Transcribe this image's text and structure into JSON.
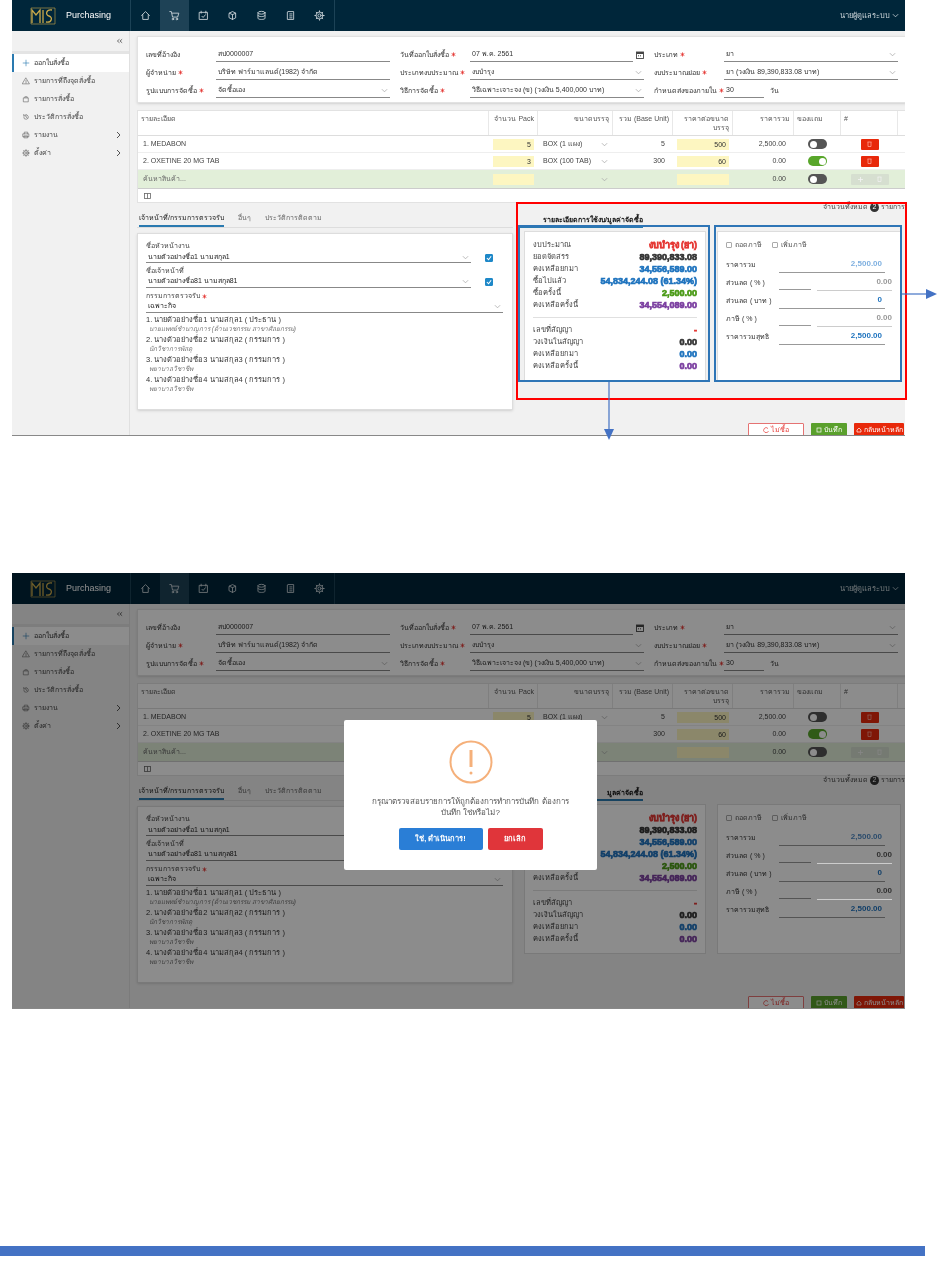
{
  "screens": [
    {
      "annotated": true,
      "app": {
        "title": "Purchasing",
        "user": "นายผู้ดูแลระบบ",
        "nav": [
          {
            "kind": "home",
            "selected": false
          },
          {
            "kind": "cart",
            "selected": true
          },
          {
            "kind": "calendar-check",
            "selected": false
          },
          {
            "kind": "package",
            "selected": false
          },
          {
            "kind": "database",
            "selected": false
          },
          {
            "kind": "document",
            "selected": false
          },
          {
            "kind": "gear",
            "selected": false
          }
        ]
      },
      "sidebar": {
        "items": [
          {
            "kind": "plus",
            "label": "ออกใบสั่งซื้อ",
            "selected": true,
            "expandable": false
          },
          {
            "kind": "warning",
            "label": "รายการที่ถึงจุดสั่งซื้อ",
            "selected": false,
            "expandable": false
          },
          {
            "kind": "bag",
            "label": "รายการสั่งซื้อ",
            "selected": false,
            "expandable": false
          },
          {
            "kind": "history",
            "label": "ประวัติการสั่งซื้อ",
            "selected": false,
            "expandable": false
          },
          {
            "kind": "printer",
            "label": "รายงาน",
            "selected": false,
            "expandable": true
          },
          {
            "kind": "gear",
            "label": "ตั้งค่า",
            "selected": false,
            "expandable": true
          }
        ]
      },
      "form": {
        "fields": [
          {
            "kind": "text",
            "label": "เลขที่อ้างอิง",
            "required": false,
            "value": "สป0000007"
          },
          {
            "kind": "date",
            "label": "วันที่ออกใบสั่งซื้อ",
            "required": true,
            "value": "07 พ.ค. 2561"
          },
          {
            "kind": "select",
            "label": "ประเภท",
            "required": true,
            "value": "ยา"
          },
          {
            "kind": "text",
            "label": "ผู้จำหน่าย",
            "required": true,
            "value": "บริษัท ฟาร์มาแลนด์(1982) จำกัด"
          },
          {
            "kind": "select",
            "label": "ประเภทงบประมาณ",
            "required": true,
            "value": "งบบำรุง"
          },
          {
            "kind": "select",
            "label": "งบประมาณย่อย",
            "required": true,
            "value": "ยา (วงเงิน 89,390,833.08 บาท)"
          },
          {
            "kind": "select",
            "label": "รูปแบบการจัดซื้อ",
            "required": true,
            "value": "จัดซื้อเอง"
          },
          {
            "kind": "select",
            "label": "วิธีการจัดซื้อ",
            "required": true,
            "value": "วิธีเฉพาะเจาะจง (ข) (วงเงิน 5,400,000 บาท)"
          },
          {
            "kind": "number",
            "label": "กำหนดส่งของภายใน",
            "required": true,
            "value": "30",
            "suffix": "วัน"
          }
        ]
      },
      "items_table": {
        "columns": [
          "รายละเอียด",
          "จำนวน Pack",
          "ขนาดบรรจุ",
          "รวม (Base Unit)",
          "ราคาต่อขนาดบรรจุ",
          "ราคารวม",
          "ของแถม",
          "#"
        ],
        "rows": [
          {
            "detail": "1. MEDABON",
            "pack": "5",
            "unit": "BOX (1 แผง)",
            "base": "5",
            "price": "500",
            "total": "2,500.00",
            "free": false
          },
          {
            "detail": "2. OXETINE 20 MG TAB",
            "pack": "3",
            "unit": "BOX (100 TAB)",
            "base": "300",
            "price": "60",
            "total": "0.00",
            "free": true
          }
        ],
        "search_row": {
          "placeholder": "ค้นหาสินค้า...",
          "total": "0.00",
          "free": false
        },
        "count": {
          "before": "จำนวนทั้งหมด",
          "value": "2",
          "after": "รายการ"
        }
      },
      "tabs": [
        {
          "label": "เจ้าหน้าที่/กรรมการตรวจรับ",
          "selected": true
        },
        {
          "label": "อื่นๆ",
          "selected": false
        },
        {
          "label": "ประวัติการติดตาม",
          "selected": false
        }
      ],
      "budget_tab": {
        "label": "รายละเอียดการใช้งบ/มูลค่าจัดซื้อ",
        "selected": true
      },
      "staff": {
        "head": {
          "label": "ชื่อหัวหน้างาน",
          "value": "นายตัวอย่างชื่อ1 นามสกุล1",
          "checked": true
        },
        "officer": {
          "label": "ชื่อเจ้าหน้าที่",
          "value": "นายตัวอย่างชื่อ81 นามสกุล81",
          "checked": true
        },
        "committee": {
          "label": "กรรมการตรวจรับ",
          "required": true,
          "value": "เฉพาะกิจ",
          "members": [
            {
              "text": "1. นายตัวอย่างชื่อ1 นามสกุล1 ( ประธาน )",
              "position": "นายแพทย์ชำนาญการ (ด้านเวชกรรม สาขาศัลยกรรม)"
            },
            {
              "text": "2. นางตัวอย่างชื่อ2 นามสกุล2 ( กรรมการ )",
              "position": "นักวิชาการพัสดุ"
            },
            {
              "text": "3. นางตัวอย่างชื่อ3 นามสกุล3 ( กรรมการ )",
              "position": "พยาบาลวิชาชีพ"
            },
            {
              "text": "4. นางตัวอย่างชื่อ4 นามสกุล4 ( กรรมการ )",
              "position": "พยาบาลวิชาชีพ"
            }
          ]
        }
      },
      "budget": {
        "rows": [
          {
            "label": "งบประมาณ",
            "value": "งบบำรุง (ยา)",
            "color": "#e53935"
          },
          {
            "label": "ยอดจัดสรร",
            "value": "89,390,833.08",
            "color": "#333333"
          },
          {
            "label": "คงเหลือยกมา",
            "value": "34,556,589.00",
            "color": "#1e73be"
          },
          {
            "label": "ซื้อไปแล้ว",
            "value": "54,834,244.08 (61.34%)",
            "color": "#1e73be"
          },
          {
            "label": "ซื้อครั้งนี้",
            "value": "2,500.00",
            "color": "#4a9a16"
          },
          {
            "label": "คงเหลือครั้งนี้",
            "value": "34,554,089.00",
            "color": "#7b3fa0"
          }
        ],
        "contract_rows": [
          {
            "label": "เลขที่สัญญา",
            "value": "-",
            "color": "#e53935"
          },
          {
            "label": "วงเงินในสัญญา",
            "value": "0.00",
            "color": "#333333"
          },
          {
            "label": "คงเหลือยกมา",
            "value": "0.00",
            "color": "#1e73be"
          },
          {
            "label": "คงเหลือครั้งนี้",
            "value": "0.00",
            "color": "#7b3fa0"
          }
        ]
      },
      "totals": {
        "tax_options": [
          {
            "label": "ถอดภาษี",
            "checked": false
          },
          {
            "label": "เพิ่มภาษี",
            "checked": false
          }
        ],
        "rows": [
          {
            "kind": "single",
            "label": "ราคารวม",
            "value": "2,500.00",
            "color": "#7fb0e0"
          },
          {
            "kind": "split",
            "label": "ส่วนลด ( % )",
            "value": "0.00",
            "color": "#999999"
          },
          {
            "kind": "single",
            "label": "ส่วนลด ( บาท )",
            "value": "0",
            "color": "#1e73be"
          },
          {
            "kind": "split",
            "label": "ภาษี ( % )",
            "value": "0.00",
            "color": "#999999"
          },
          {
            "kind": "single",
            "label": "ราคารวมสุทธิ",
            "value": "2,500.00",
            "color": "#1e73be"
          }
        ]
      },
      "actions": [
        {
          "kind": "reset",
          "label": "ไม่ซื้อ"
        },
        {
          "kind": "save",
          "label": "บันทึก"
        },
        {
          "kind": "back",
          "label": "กลับหน้าหลัก"
        }
      ]
    },
    {
      "annotated": false,
      "app": {
        "title": "Purchasing",
        "user": "นายผู้ดูแลระบบ",
        "nav": [
          {
            "kind": "home",
            "selected": false
          },
          {
            "kind": "cart",
            "selected": true
          },
          {
            "kind": "calendar-check",
            "selected": false
          },
          {
            "kind": "package",
            "selected": false
          },
          {
            "kind": "database",
            "selected": false
          },
          {
            "kind": "document",
            "selected": false
          },
          {
            "kind": "gear",
            "selected": false
          }
        ]
      },
      "sidebar": {
        "items": [
          {
            "kind": "plus",
            "label": "ออกใบสั่งซื้อ",
            "selected": true,
            "expandable": false
          },
          {
            "kind": "warning",
            "label": "รายการที่ถึงจุดสั่งซื้อ",
            "selected": false,
            "expandable": false
          },
          {
            "kind": "bag",
            "label": "รายการสั่งซื้อ",
            "selected": false,
            "expandable": false
          },
          {
            "kind": "history",
            "label": "ประวัติการสั่งซื้อ",
            "selected": false,
            "expandable": false
          },
          {
            "kind": "printer",
            "label": "รายงาน",
            "selected": false,
            "expandable": true
          },
          {
            "kind": "gear",
            "label": "ตั้งค่า",
            "selected": false,
            "expandable": true
          }
        ]
      },
      "form": {
        "fields": [
          {
            "kind": "text",
            "label": "เลขที่อ้างอิง",
            "required": false,
            "value": "สป0000007"
          },
          {
            "kind": "date",
            "label": "วันที่ออกใบสั่งซื้อ",
            "required": true,
            "value": "07 พ.ค. 2561"
          },
          {
            "kind": "select",
            "label": "ประเภท",
            "required": true,
            "value": "ยา"
          },
          {
            "kind": "text",
            "label": "ผู้จำหน่าย",
            "required": true,
            "value": "บริษัท ฟาร์มาแลนด์(1982) จำกัด"
          },
          {
            "kind": "select",
            "label": "ประเภทงบประมาณ",
            "required": true,
            "value": "งบบำรุง"
          },
          {
            "kind": "select",
            "label": "งบประมาณย่อย",
            "required": true,
            "value": "ยา (วงเงิน 89,390,833.08 บาท)"
          },
          {
            "kind": "select",
            "label": "รูปแบบการจัดซื้อ",
            "required": true,
            "value": "จัดซื้อเอง"
          },
          {
            "kind": "select",
            "label": "วิธีการจัดซื้อ",
            "required": true,
            "value": "วิธีเฉพาะเจาะจง (ข) (วงเงิน 5,400,000 บาท)"
          },
          {
            "kind": "number",
            "label": "กำหนดส่งของภายใน",
            "required": true,
            "value": "30",
            "suffix": "วัน"
          }
        ]
      },
      "items_table": {
        "columns": [
          "รายละเอียด",
          "จำนวน Pack",
          "ขนาดบรรจุ",
          "รวม (Base Unit)",
          "ราคาต่อขนาดบรรจุ",
          "ราคารวม",
          "ของแถม",
          "#"
        ],
        "rows": [
          {
            "detail": "1. MEDABON",
            "pack": "5",
            "unit": "BOX (1 แผง)",
            "base": "5",
            "price": "500",
            "total": "2,500.00",
            "free": false
          },
          {
            "detail": "2. OXETINE 20 MG TAB",
            "base": "300",
            "price": "60",
            "total": "0.00",
            "free": true
          }
        ],
        "search_row": {
          "placeholder": "ค้นหาสินค้า...",
          "total": "0.00",
          "free": false
        },
        "count": {
          "before": "จำนวนทั้งหมด",
          "value": "2",
          "after": "รายการ"
        }
      },
      "tabs": [
        {
          "label": "เจ้าหน้าที่/กรรมการตรวจรับ",
          "selected": true
        },
        {
          "label": "อื่นๆ",
          "selected": false
        },
        {
          "label": "ประวัติการติดตาม",
          "selected": false
        }
      ],
      "budget_tab": {
        "label": "มูลค่าจัดซื้อ",
        "selected": true
      },
      "staff": {
        "head": {
          "label": "ชื่อหัวหน้างาน",
          "value": "นายตัวอย่างชื่อ1 นามสกุล1"
        },
        "officer": {
          "label": "ชื่อเจ้าหน้าที่",
          "value": "นายตัวอย่างชื่อ81 นามสกุล81"
        },
        "committee": {
          "label": "กรรมการตรวจรับ",
          "required": true,
          "value": "เฉพาะกิจ",
          "members": [
            {
              "text": "1. นายตัวอย่างชื่อ1 นามสกุล1 ( ประธาน )",
              "position": "นายแพทย์ชำนาญการ (ด้านเวชกรรม สาขาศัลยกรรม)"
            },
            {
              "text": "2. นางตัวอย่างชื่อ2 นามสกุล2 ( กรรมการ )",
              "position": "นักวิชาการพัสดุ"
            },
            {
              "text": "3. นางตัวอย่างชื่อ3 นามสกุล3 ( กรรมการ )",
              "position": "พยาบาลวิชาชีพ"
            },
            {
              "text": "4. นางตัวอย่างชื่อ4 นามสกุล4 ( กรรมการ )",
              "position": "พยาบาลวิชาชีพ"
            }
          ]
        }
      },
      "budget": {
        "rows": [
          {
            "value": "งบบำรุง (ยา)",
            "color": "#7e1f1d"
          },
          {
            "value": "89,390,833.08",
            "color": "#1c1c1c"
          },
          {
            "value": "34,556,589.00",
            "color": "#113f69"
          },
          {
            "value": "54,834,244.08 (61.34%)",
            "color": "#113f69"
          },
          {
            "value": "2,500.00",
            "color": "#29550c"
          },
          {
            "label": "คงเหลือครั้งนี้",
            "value": "34,554,089.00",
            "color": "#442358"
          }
        ],
        "contract_rows": [
          {
            "label": "เลขที่สัญญา",
            "value": "-",
            "color": "#7e1f1d"
          },
          {
            "label": "วงเงินในสัญญา",
            "value": "0.00",
            "color": "#1c1c1c"
          },
          {
            "label": "คงเหลือยกมา",
            "value": "0.00",
            "color": "#113f69"
          },
          {
            "label": "คงเหลือครั้งนี้",
            "value": "0.00",
            "color": "#442358"
          }
        ]
      },
      "totals": {
        "tax_options": [
          {
            "label": "ถอดภาษี",
            "checked": false
          },
          {
            "label": "เพิ่มภาษี",
            "checked": false
          }
        ],
        "rows": [
          {
            "kind": "single",
            "label": "ราคารวม",
            "value": "2,500.00",
            "color": "#2c4c6c"
          },
          {
            "kind": "split",
            "label": "ส่วนลด ( % )",
            "value": "0.00",
            "color": "#303030"
          },
          {
            "kind": "single",
            "label": "ส่วนลด ( บาท )",
            "value": "0",
            "color": "#113f69"
          },
          {
            "kind": "split",
            "label": "ภาษี ( % )",
            "value": "0.00",
            "color": "#303030"
          },
          {
            "kind": "single",
            "label": "ราคารวมสุทธิ",
            "value": "2,500.00",
            "color": "#113f69"
          }
        ]
      },
      "actions": [
        {
          "kind": "reset",
          "label": "ไม่ซื้อ"
        },
        {
          "kind": "save",
          "label": "บันทึก"
        },
        {
          "kind": "back",
          "label": "กลับหน้าหลัก"
        }
      ],
      "dialog": {
        "message": "กรุณาตรวจสอบรายการให้ถูกต้องการทำการบันทึก ต้องการบันทึก ใช่หรือไม่?",
        "buttons": [
          {
            "kind": "confirm",
            "label": "ใช่, ดำเนินการ!"
          },
          {
            "kind": "cancel",
            "label": "ยกเลิก"
          }
        ]
      }
    }
  ]
}
